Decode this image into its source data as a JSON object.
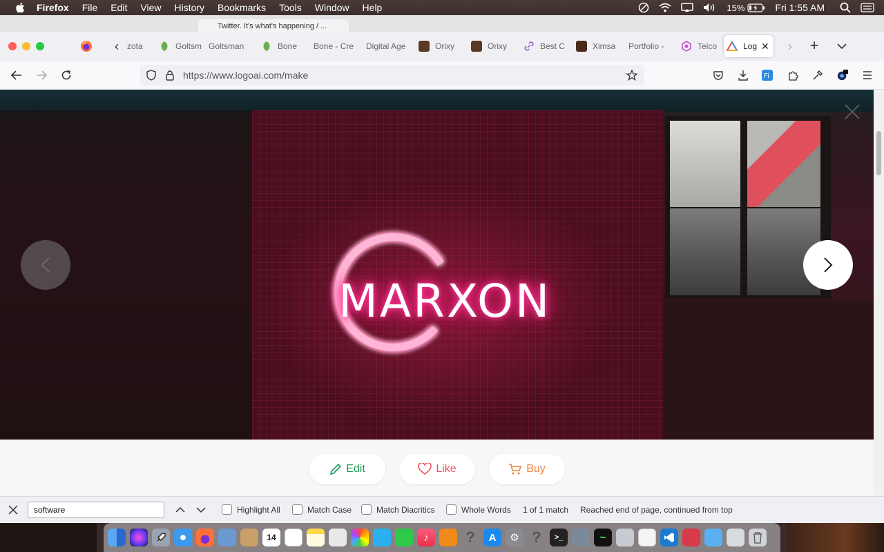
{
  "menubar": {
    "app_name": "Firefox",
    "items": [
      "File",
      "Edit",
      "View",
      "History",
      "Bookmarks",
      "Tools",
      "Window",
      "Help"
    ],
    "battery": "15%",
    "clock": "Fri 1:55 AM"
  },
  "ghost_tab": {
    "label": "Twitter. It's what's happening / ..."
  },
  "tabs": [
    {
      "label": "zota",
      "favicon": "generic",
      "color": "#888888"
    },
    {
      "label": "Goltsman",
      "favicon": "leaf",
      "color": "#6ab04c"
    },
    {
      "label": "Goltsman",
      "favicon": "none",
      "color": ""
    },
    {
      "label": "Bone",
      "favicon": "leaf",
      "color": "#6ab04c"
    },
    {
      "label": "Bone - Cre",
      "favicon": "none",
      "color": ""
    },
    {
      "label": "Digital Age",
      "favicon": "none",
      "color": ""
    },
    {
      "label": "Orixy",
      "favicon": "photo",
      "color": "#5a3a22"
    },
    {
      "label": "Orixy",
      "favicon": "photo",
      "color": "#5a3a22"
    },
    {
      "label": "Best C",
      "favicon": "link",
      "color": "#8a5ac8"
    },
    {
      "label": "Ximsa",
      "favicon": "photo",
      "color": "#4a2a1a"
    },
    {
      "label": "Portfolio -",
      "favicon": "none",
      "color": ""
    },
    {
      "label": "Telco",
      "favicon": "hex",
      "color": "#c84fd0"
    },
    {
      "label": "Log",
      "favicon": "logoai",
      "color": "#e03a3a",
      "active": true
    }
  ],
  "navbar": {
    "url": "https://www.logoai.com/make"
  },
  "hero": {
    "logo_text": "MARXON",
    "brand_color": "#ff2a8a"
  },
  "actions": {
    "edit": "Edit",
    "like": "Like",
    "buy": "Buy",
    "edit_color": "#1d9a5b",
    "like_color": "#f0505a",
    "buy_color": "#f0823c"
  },
  "findbar": {
    "query": "software",
    "highlight_all": "Highlight All",
    "match_case": "Match Case",
    "match_diacritics": "Match Diacritics",
    "whole_words": "Whole Words",
    "match_count": "1 of 1 match",
    "status": "Reached end of page, continued from top"
  },
  "dock": {
    "icons": [
      "finder",
      "siri",
      "launchpad",
      "safari",
      "firefox",
      "preview",
      "contacts",
      "calendar",
      "reminders",
      "notes",
      "photos-browser",
      "photos",
      "messages",
      "facetime",
      "music",
      "books",
      "help",
      "app-store",
      "system-preferences",
      "help",
      "terminal",
      "screenshots",
      "activity-monitor",
      "disk-utility",
      "textedit",
      "vscode",
      "database",
      "finder-folder",
      "migration",
      "trash"
    ],
    "calendar_day": "14"
  }
}
